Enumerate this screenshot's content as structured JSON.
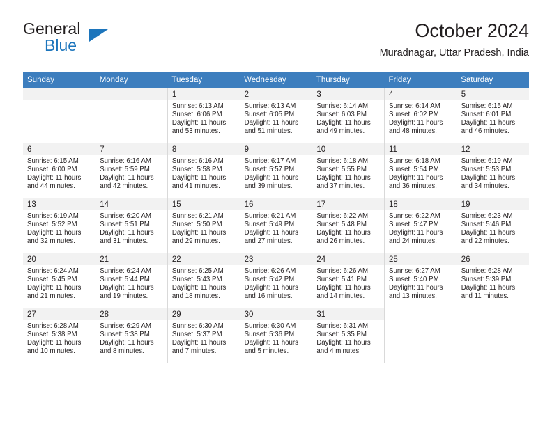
{
  "brand": {
    "name_top": "General",
    "name_bottom": "Blue",
    "accent_color": "#1c75bc"
  },
  "header": {
    "title": "October 2024",
    "subtitle": "Muradnagar, Uttar Pradesh, India"
  },
  "calendar": {
    "header_bg": "#3d7ebe",
    "daynum_bg": "#f2f2f2",
    "weekday_headers": [
      "Sunday",
      "Monday",
      "Tuesday",
      "Wednesday",
      "Thursday",
      "Friday",
      "Saturday"
    ],
    "weeks": [
      [
        {
          "day": "",
          "lines": []
        },
        {
          "day": "",
          "lines": []
        },
        {
          "day": "1",
          "lines": [
            "Sunrise: 6:13 AM",
            "Sunset: 6:06 PM",
            "Daylight: 11 hours",
            "and 53 minutes."
          ]
        },
        {
          "day": "2",
          "lines": [
            "Sunrise: 6:13 AM",
            "Sunset: 6:05 PM",
            "Daylight: 11 hours",
            "and 51 minutes."
          ]
        },
        {
          "day": "3",
          "lines": [
            "Sunrise: 6:14 AM",
            "Sunset: 6:03 PM",
            "Daylight: 11 hours",
            "and 49 minutes."
          ]
        },
        {
          "day": "4",
          "lines": [
            "Sunrise: 6:14 AM",
            "Sunset: 6:02 PM",
            "Daylight: 11 hours",
            "and 48 minutes."
          ]
        },
        {
          "day": "5",
          "lines": [
            "Sunrise: 6:15 AM",
            "Sunset: 6:01 PM",
            "Daylight: 11 hours",
            "and 46 minutes."
          ]
        }
      ],
      [
        {
          "day": "6",
          "lines": [
            "Sunrise: 6:15 AM",
            "Sunset: 6:00 PM",
            "Daylight: 11 hours",
            "and 44 minutes."
          ]
        },
        {
          "day": "7",
          "lines": [
            "Sunrise: 6:16 AM",
            "Sunset: 5:59 PM",
            "Daylight: 11 hours",
            "and 42 minutes."
          ]
        },
        {
          "day": "8",
          "lines": [
            "Sunrise: 6:16 AM",
            "Sunset: 5:58 PM",
            "Daylight: 11 hours",
            "and 41 minutes."
          ]
        },
        {
          "day": "9",
          "lines": [
            "Sunrise: 6:17 AM",
            "Sunset: 5:57 PM",
            "Daylight: 11 hours",
            "and 39 minutes."
          ]
        },
        {
          "day": "10",
          "lines": [
            "Sunrise: 6:18 AM",
            "Sunset: 5:55 PM",
            "Daylight: 11 hours",
            "and 37 minutes."
          ]
        },
        {
          "day": "11",
          "lines": [
            "Sunrise: 6:18 AM",
            "Sunset: 5:54 PM",
            "Daylight: 11 hours",
            "and 36 minutes."
          ]
        },
        {
          "day": "12",
          "lines": [
            "Sunrise: 6:19 AM",
            "Sunset: 5:53 PM",
            "Daylight: 11 hours",
            "and 34 minutes."
          ]
        }
      ],
      [
        {
          "day": "13",
          "lines": [
            "Sunrise: 6:19 AM",
            "Sunset: 5:52 PM",
            "Daylight: 11 hours",
            "and 32 minutes."
          ]
        },
        {
          "day": "14",
          "lines": [
            "Sunrise: 6:20 AM",
            "Sunset: 5:51 PM",
            "Daylight: 11 hours",
            "and 31 minutes."
          ]
        },
        {
          "day": "15",
          "lines": [
            "Sunrise: 6:21 AM",
            "Sunset: 5:50 PM",
            "Daylight: 11 hours",
            "and 29 minutes."
          ]
        },
        {
          "day": "16",
          "lines": [
            "Sunrise: 6:21 AM",
            "Sunset: 5:49 PM",
            "Daylight: 11 hours",
            "and 27 minutes."
          ]
        },
        {
          "day": "17",
          "lines": [
            "Sunrise: 6:22 AM",
            "Sunset: 5:48 PM",
            "Daylight: 11 hours",
            "and 26 minutes."
          ]
        },
        {
          "day": "18",
          "lines": [
            "Sunrise: 6:22 AM",
            "Sunset: 5:47 PM",
            "Daylight: 11 hours",
            "and 24 minutes."
          ]
        },
        {
          "day": "19",
          "lines": [
            "Sunrise: 6:23 AM",
            "Sunset: 5:46 PM",
            "Daylight: 11 hours",
            "and 22 minutes."
          ]
        }
      ],
      [
        {
          "day": "20",
          "lines": [
            "Sunrise: 6:24 AM",
            "Sunset: 5:45 PM",
            "Daylight: 11 hours",
            "and 21 minutes."
          ]
        },
        {
          "day": "21",
          "lines": [
            "Sunrise: 6:24 AM",
            "Sunset: 5:44 PM",
            "Daylight: 11 hours",
            "and 19 minutes."
          ]
        },
        {
          "day": "22",
          "lines": [
            "Sunrise: 6:25 AM",
            "Sunset: 5:43 PM",
            "Daylight: 11 hours",
            "and 18 minutes."
          ]
        },
        {
          "day": "23",
          "lines": [
            "Sunrise: 6:26 AM",
            "Sunset: 5:42 PM",
            "Daylight: 11 hours",
            "and 16 minutes."
          ]
        },
        {
          "day": "24",
          "lines": [
            "Sunrise: 6:26 AM",
            "Sunset: 5:41 PM",
            "Daylight: 11 hours",
            "and 14 minutes."
          ]
        },
        {
          "day": "25",
          "lines": [
            "Sunrise: 6:27 AM",
            "Sunset: 5:40 PM",
            "Daylight: 11 hours",
            "and 13 minutes."
          ]
        },
        {
          "day": "26",
          "lines": [
            "Sunrise: 6:28 AM",
            "Sunset: 5:39 PM",
            "Daylight: 11 hours",
            "and 11 minutes."
          ]
        }
      ],
      [
        {
          "day": "27",
          "lines": [
            "Sunrise: 6:28 AM",
            "Sunset: 5:38 PM",
            "Daylight: 11 hours",
            "and 10 minutes."
          ]
        },
        {
          "day": "28",
          "lines": [
            "Sunrise: 6:29 AM",
            "Sunset: 5:38 PM",
            "Daylight: 11 hours",
            "and 8 minutes."
          ]
        },
        {
          "day": "29",
          "lines": [
            "Sunrise: 6:30 AM",
            "Sunset: 5:37 PM",
            "Daylight: 11 hours",
            "and 7 minutes."
          ]
        },
        {
          "day": "30",
          "lines": [
            "Sunrise: 6:30 AM",
            "Sunset: 5:36 PM",
            "Daylight: 11 hours",
            "and 5 minutes."
          ]
        },
        {
          "day": "31",
          "lines": [
            "Sunrise: 6:31 AM",
            "Sunset: 5:35 PM",
            "Daylight: 11 hours",
            "and 4 minutes."
          ]
        },
        {
          "day": "",
          "lines": [],
          "blank": true
        },
        {
          "day": "",
          "lines": [],
          "blank": true
        }
      ]
    ]
  }
}
